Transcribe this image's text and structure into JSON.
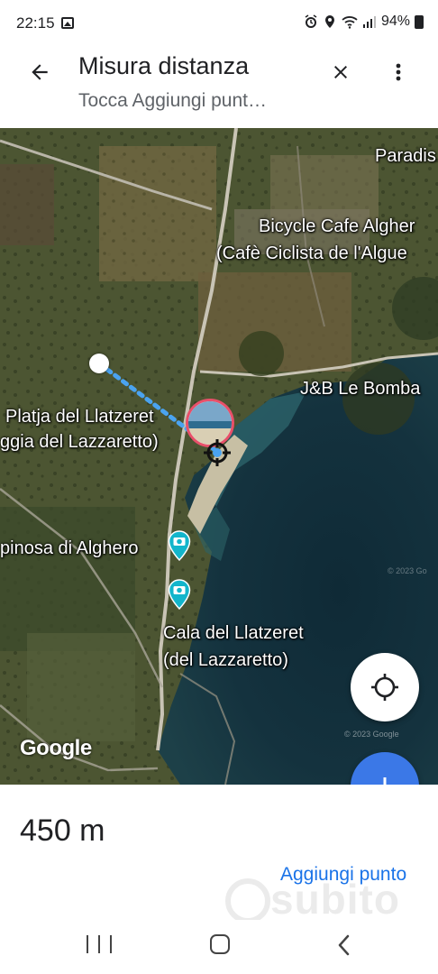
{
  "status_bar": {
    "time": "22:15",
    "battery": "94%"
  },
  "app_bar": {
    "title": "Misura distanza",
    "subtitle": "Tocca Aggiungi punt…",
    "back_icon": "arrow-back-icon",
    "close_icon": "close-icon",
    "menu_icon": "more-vert-icon"
  },
  "map": {
    "labels": {
      "paradis": "Paradis",
      "bicycle_cafe_1": "Bicycle Cafe Algher",
      "bicycle_cafe_2": "(Cafè Ciclista de l'Algue",
      "jb": "J&B Le Bomba",
      "platja_1": "Platja del Llatzeret",
      "platja_2": "ggia del Lazzaretto)",
      "spinosa": "pinosa di Alghero",
      "cala_1": "Cala del Llatzeret",
      "cala_2": "(del Lazzaretto)"
    },
    "logo": "Google",
    "copyright": "© 2023 Google",
    "copyright_short": "© 2023 Go",
    "colors": {
      "measure_line": "#4aa3f0",
      "accent": "#3b78e7",
      "pin_ring": "#e8506a"
    }
  },
  "controls": {
    "locate_icon": "my-location-icon",
    "add_icon": "plus-icon"
  },
  "bottom_sheet": {
    "distance": "450 m",
    "add_point": "Aggiungi punto",
    "watermark": "subito"
  }
}
